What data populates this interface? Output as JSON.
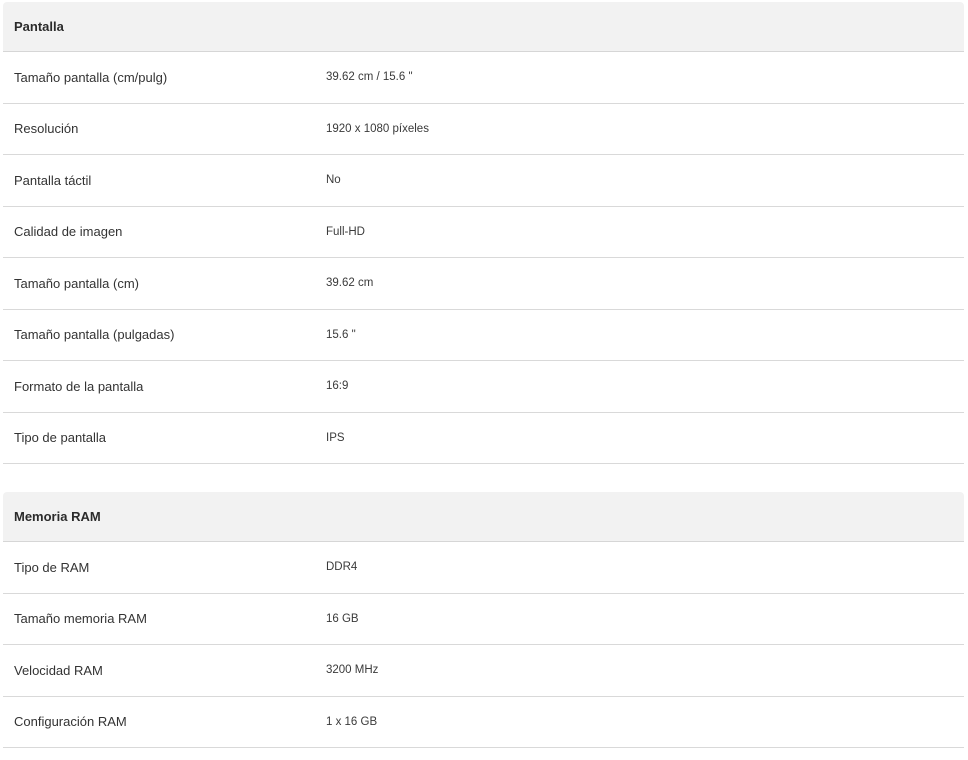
{
  "sections": [
    {
      "title": "Pantalla",
      "rows": [
        {
          "label": "Tamaño pantalla (cm/pulg)",
          "value": "39.62 cm / 15.6 \""
        },
        {
          "label": "Resolución",
          "value": "1920 x 1080 píxeles"
        },
        {
          "label": "Pantalla táctil",
          "value": "No"
        },
        {
          "label": "Calidad de imagen",
          "value": "Full-HD"
        },
        {
          "label": "Tamaño pantalla (cm)",
          "value": "39.62 cm"
        },
        {
          "label": "Tamaño pantalla (pulgadas)",
          "value": "15.6 \""
        },
        {
          "label": "Formato de la pantalla",
          "value": "16:9"
        },
        {
          "label": "Tipo de pantalla",
          "value": "IPS"
        }
      ]
    },
    {
      "title": "Memoria RAM",
      "rows": [
        {
          "label": "Tipo de RAM",
          "value": "DDR4"
        },
        {
          "label": "Tamaño memoria RAM",
          "value": "16 GB"
        },
        {
          "label": "Velocidad RAM",
          "value": "3200 MHz"
        },
        {
          "label": "Configuración RAM",
          "value": "1 x 16 GB"
        }
      ]
    }
  ]
}
